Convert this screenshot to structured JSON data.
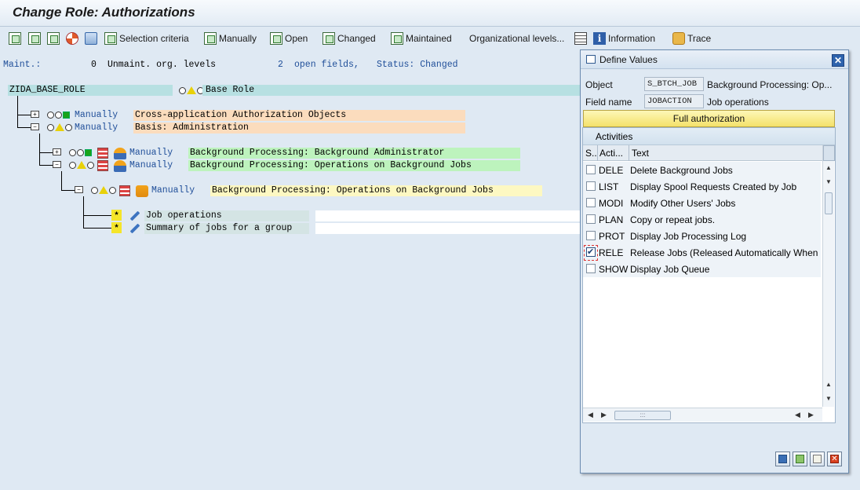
{
  "title": "Change Role: Authorizations",
  "toolbar": {
    "selection_criteria": "Selection criteria",
    "manually": "Manually",
    "open": "Open",
    "changed": "Changed",
    "maintained": "Maintained",
    "org_levels": "Organizational levels...",
    "information": "Information",
    "trace": "Trace"
  },
  "status": {
    "maint_label": "Maint.:",
    "maint_count": "0",
    "unmaint_label": "Unmaint. org. levels",
    "open_count": "2",
    "open_label": "open fields,",
    "status_text": "Status: Changed"
  },
  "tree": {
    "root": {
      "name": "ZIDA_BASE_ROLE",
      "desc": "Base Role"
    },
    "level1": [
      {
        "status": "Manually",
        "desc": "Cross-application Authorization Objects",
        "color": "#fbdcbd"
      },
      {
        "status": "Manually",
        "desc": "Basis: Administration",
        "color": "#fbdcbd"
      }
    ],
    "level2": [
      {
        "status": "Manually",
        "desc": "Background Processing: Background Administrator",
        "color": "#bdf3bd"
      },
      {
        "status": "Manually",
        "desc": "Background Processing: Operations on Background Jobs",
        "color": "#bdf3bd"
      }
    ],
    "level3": {
      "status": "Manually",
      "desc": "Background Processing: Operations on Background Jobs",
      "color": "#fdf8c2"
    },
    "fields": [
      {
        "marker": "*",
        "desc": "Job operations"
      },
      {
        "marker": "*",
        "desc": "Summary of jobs for a group"
      }
    ]
  },
  "dialog": {
    "title": "Define Values",
    "object_label": "Object",
    "object_value": "S_BTCH_JOB",
    "object_desc": "Background Processing: Op...",
    "field_label": "Field name",
    "field_value": "JOBACTION",
    "field_desc": "Job operations",
    "full_auth": "Full authorization",
    "activities_title": "Activities",
    "columns": {
      "sel": "S..",
      "activity": "Acti...",
      "text": "Text"
    },
    "rows": [
      {
        "code": "DELE",
        "text": "Delete Background Jobs",
        "checked": false
      },
      {
        "code": "LIST",
        "text": "Display Spool Requests Created by Job",
        "checked": false
      },
      {
        "code": "MODI",
        "text": "Modify Other Users' Jobs",
        "checked": false
      },
      {
        "code": "PLAN",
        "text": "Copy or repeat jobs.",
        "checked": false
      },
      {
        "code": "PROT",
        "text": "Display Job Processing Log",
        "checked": false
      },
      {
        "code": "RELE",
        "text": "Release Jobs (Released Automatically When",
        "checked": true
      },
      {
        "code": "SHOW",
        "text": "Display Job Queue",
        "checked": false
      }
    ]
  },
  "icons": {
    "toolbar": [
      "expand-icon",
      "collapse-icon",
      "open-node-icon",
      "deactivate-icon",
      "delete-icon",
      "selection-criteria-icon",
      "manually-icon",
      "open-icon",
      "changed-icon",
      "maintained-icon",
      "grid-icon",
      "information-icon",
      "trace-icon"
    ],
    "footer": [
      "save-icon",
      "copy-values-icon",
      "edit-icon",
      "cancel-icon"
    ]
  },
  "colors": {
    "teal": "#b7e0e2",
    "orange": "#fbdcbd",
    "green": "#bdf3bd",
    "yellow": "#fdf8c2",
    "full_auth": "#f4e16a",
    "link": "#1f4e99"
  }
}
